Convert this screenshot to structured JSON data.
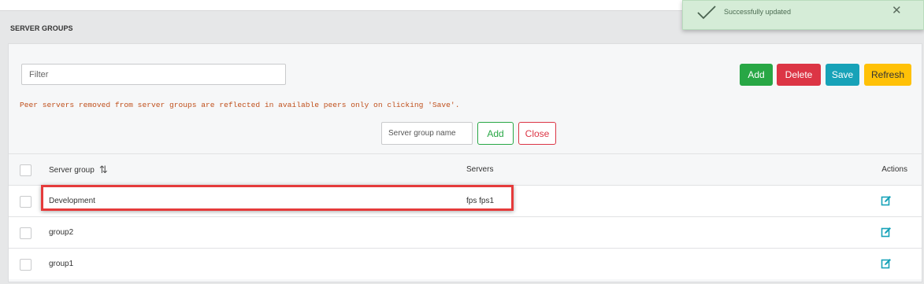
{
  "section": {
    "title": "SERVER GROUPS"
  },
  "toolbar": {
    "filter_placeholder": "Filter",
    "add_label": "Add",
    "delete_label": "Delete",
    "save_label": "Save",
    "refresh_label": "Refresh"
  },
  "note": "Peer servers removed from server groups are reflected in available peers only on clicking 'Save'.",
  "new_group": {
    "placeholder": "Server group name",
    "add_label": "Add",
    "close_label": "Close"
  },
  "table": {
    "headers": {
      "group": "Server group",
      "servers": "Servers",
      "actions": "Actions"
    },
    "rows": [
      {
        "group": "Development",
        "servers": "fps fps1"
      },
      {
        "group": "group2",
        "servers": ""
      },
      {
        "group": "group1",
        "servers": ""
      }
    ]
  },
  "toast": {
    "message": "Successfully updated"
  },
  "icons": {
    "sort": "sort-icon",
    "edit": "edit-icon",
    "check": "check-icon",
    "close": "close-icon"
  },
  "colors": {
    "add": "#28a745",
    "delete": "#dc3545",
    "save": "#17a2b8",
    "refresh": "#ffc107",
    "highlight": "#e53b3b",
    "edit_icon": "#17a2b8"
  }
}
